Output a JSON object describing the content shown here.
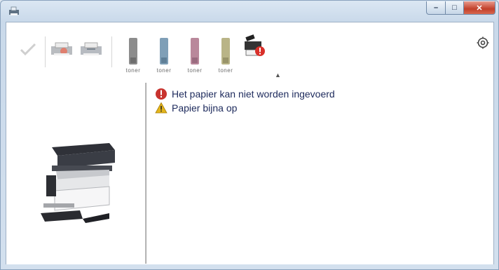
{
  "window": {
    "buttons": {
      "minimize": "–",
      "maximize": "□",
      "close": "✕"
    },
    "accent_close": "#c2402a"
  },
  "toolbar": {
    "tools": [
      {
        "name": "check-icon"
      },
      {
        "name": "printer-status-icon"
      },
      {
        "name": "printer-queue-icon"
      }
    ],
    "toners": [
      {
        "label": "toner",
        "color": "#8c8c8c",
        "name": "black-toner"
      },
      {
        "label": "toner",
        "color": "#7f9fb7",
        "name": "cyan-toner"
      },
      {
        "label": "toner",
        "color": "#b9889b",
        "name": "magenta-toner"
      },
      {
        "label": "toner",
        "color": "#b9b487",
        "name": "yellow-toner"
      }
    ],
    "alert_device_icon": "printer-error-icon",
    "collapse_glyph": "▲",
    "settings_icon": "settings-icon"
  },
  "messages": [
    {
      "icon": "error-icon",
      "text": "Het papier kan niet worden ingevoerd",
      "color": "#c8332e"
    },
    {
      "icon": "warning-icon",
      "text": "Papier bijna op",
      "color": "#e3b51b"
    }
  ]
}
